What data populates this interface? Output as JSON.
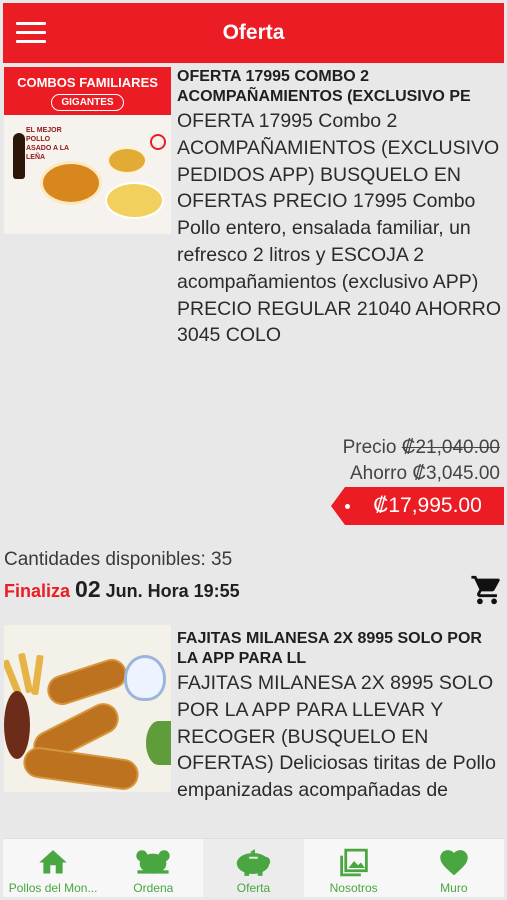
{
  "header": {
    "title": "Oferta"
  },
  "offers": [
    {
      "image": {
        "label_top": "COMBOS FAMILIARES",
        "label_chip": "GIGANTES",
        "label_tag": "EL MEJOR POLLO ASADO A LA LEÑA"
      },
      "title": "OFERTA 17995 Combo 2 ACOMPAÑAMIENTOS (EXCLUSIVO PE",
      "description": "OFERTA 17995 Combo 2 ACOMPAÑAMIENTOS (EXCLUSIVO PEDIDOS APP) BUSQUELO EN OFERTAS PRECIO 17995 Combo Pollo entero, ensalada familiar, un refresco 2 litros y ESCOJA 2 acompañamientos (exclusivo APP) PRECIO REGULAR 21040 AHORRO 3045 COLO",
      "price_label": "Precio",
      "regular_price": "₡21,040.00",
      "saving_label": "Ahorro",
      "saving_amount": "₡3,045.00",
      "offer_price": "₡17,995.00",
      "stock_label": "Cantidades disponibles:",
      "stock_value": "35",
      "ends_label": "Finaliza",
      "ends_day": "02",
      "ends_rest": "Jun. Hora 19:55"
    },
    {
      "title": "FAJITAS MILANESA 2X 8995 SOLO POR LA APP PARA LL",
      "description": "FAJITAS MILANESA 2X 8995 SOLO POR LA APP PARA LLEVAR Y RECOGER (BUSQUELO EN OFERTAS) Deliciosas tiritas de Pollo empanizadas acompañadas de"
    }
  ],
  "bottom_nav": [
    {
      "label": "Pollos del Mon...",
      "icon": "home-icon",
      "active": false
    },
    {
      "label": "Ordena",
      "icon": "chicken-icon",
      "active": false
    },
    {
      "label": "Oferta",
      "icon": "piggy-bank-icon",
      "active": true
    },
    {
      "label": "Nosotros",
      "icon": "gallery-icon",
      "active": false
    },
    {
      "label": "Muro",
      "icon": "heart-icon",
      "active": false
    }
  ],
  "colors": {
    "brand_red": "#ec1c24",
    "nav_green": "#49a641",
    "background": "#e8e8e8"
  }
}
